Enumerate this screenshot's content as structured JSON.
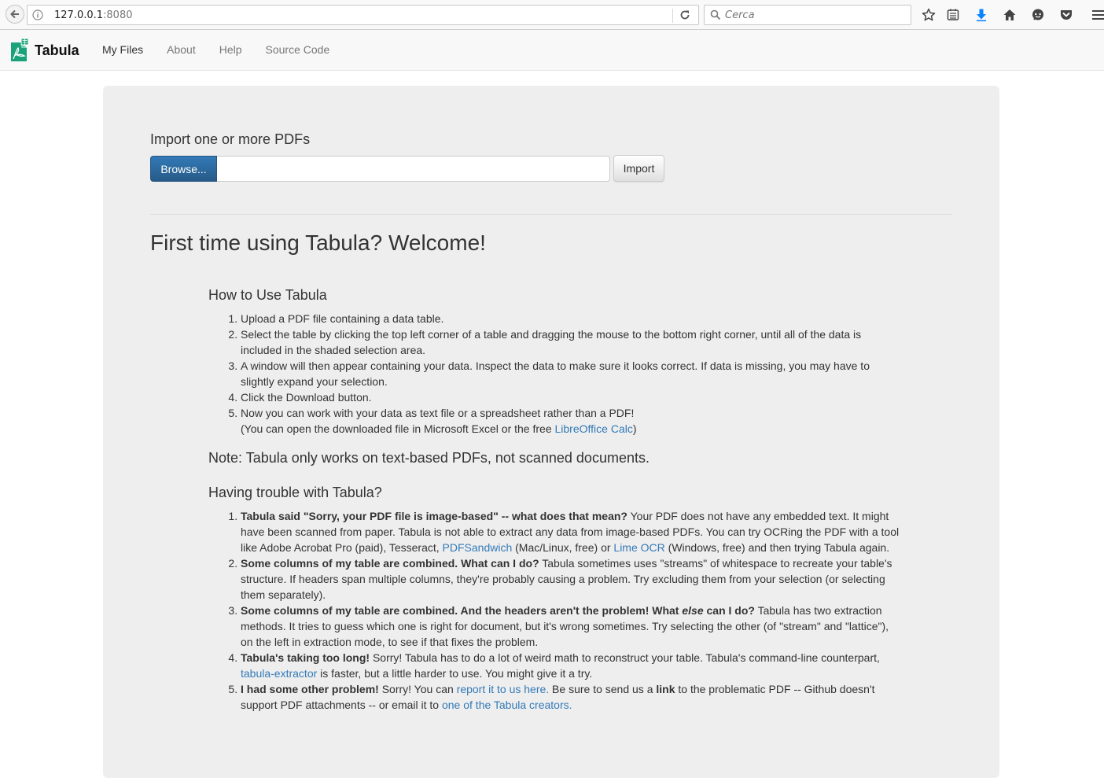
{
  "browser": {
    "url_host": "127.0.0.1",
    "url_port": ":8080",
    "search_placeholder": "Cerca"
  },
  "app": {
    "brand": "Tabula",
    "brand_color": "#1aa37a",
    "nav": [
      "My Files",
      "About",
      "Help",
      "Source Code"
    ]
  },
  "import": {
    "title": "Import one or more PDFs",
    "browse_label": "Browse...",
    "import_label": "Import"
  },
  "welcome": {
    "title": "First time using Tabula? Welcome!",
    "how_to_title": "How to Use Tabula",
    "steps": [
      "Upload a PDF file containing a data table.",
      "Select the table by clicking the top left corner of a table and dragging the mouse to the bottom right corner, until all of the data is included in the shaded selection area.",
      "A window will then appear containing your data. Inspect the data to make sure it looks correct. If data is missing, you may have to slightly expand your selection.",
      "Click the Download button.",
      "Now you can work with your data as text file or a spreadsheet rather than a PDF!"
    ],
    "step5_note_pre": "(You can open the downloaded file in Microsoft Excel or the free ",
    "step5_link": "LibreOffice Calc",
    "step5_note_post": ")",
    "note": "Note: Tabula only works on text-based PDFs, not scanned documents.",
    "trouble_title": "Having trouble with Tabula?"
  },
  "trouble": {
    "q1_bold": "Tabula said \"Sorry, your PDF file is image-based\" -- what does that mean?",
    "q1_text_a": " Your PDF does not have any embedded text. It might have been scanned from paper. Tabula is not able to extract any data from image-based PDFs. You can try OCRing the PDF with a tool like Adobe Acrobat Pro (paid), Tesseract, ",
    "q1_link1": "PDFSandwich",
    "q1_text_b": " (Mac/Linux, free) or ",
    "q1_link2": "Lime OCR",
    "q1_text_c": " (Windows, free) and then trying Tabula again.",
    "q2_bold": "Some columns of my table are combined. What can I do?",
    "q2_text": " Tabula sometimes uses \"streams\" of whitespace to recreate your table's structure. If headers span multiple columns, they're probably causing a problem. Try excluding them from your selection (or selecting them separately).",
    "q3_bold_a": "Some columns of my table are combined. And the headers aren't the problem! What ",
    "q3_bold_em": "else",
    "q3_bold_b": " can I do?",
    "q3_text": " Tabula has two extraction methods. It tries to guess which one is right for document, but it's wrong sometimes. Try selecting the other (of \"stream\" and \"lattice\"), on the left in extraction mode, to see if that fixes the problem.",
    "q4_bold": "Tabula's taking too long!",
    "q4_text_a": " Sorry! Tabula has to do a lot of weird math to reconstruct your table. Tabula's command-line counterpart, ",
    "q4_link": "tabula-extractor",
    "q4_text_b": " is faster, but a little harder to use. You might give it a try.",
    "q5_bold": "I had some other problem!",
    "q5_text_a": " Sorry! You can ",
    "q5_link1": "report it to us here.",
    "q5_text_b": " Be sure to send us a ",
    "q5_bold2": "link",
    "q5_text_c": " to the problematic PDF -- Github doesn't support PDF attachments -- or email it to ",
    "q5_link2": "one of the Tabula creators."
  }
}
